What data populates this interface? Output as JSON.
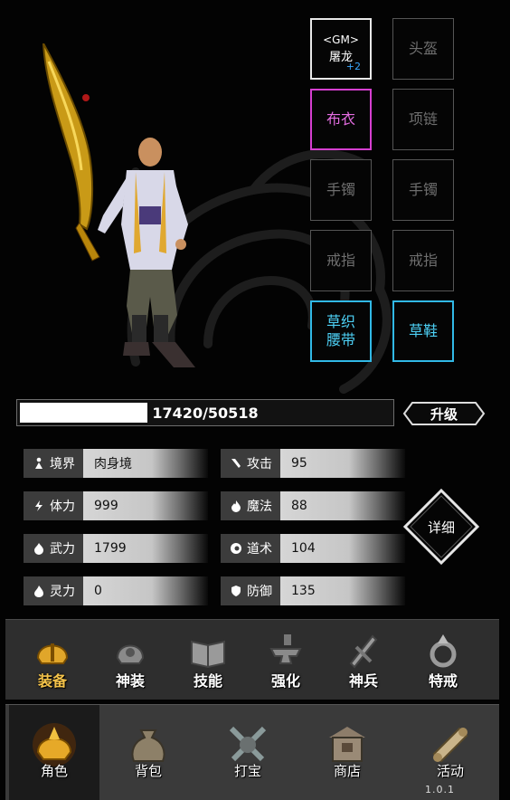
{
  "equipment": {
    "weapon": {
      "tag": "<GM>",
      "name": "屠龙",
      "plus": "+2"
    },
    "helmet": "头盔",
    "armor": "布衣",
    "necklace": "项链",
    "bracelet_left": "手镯",
    "bracelet_right": "手镯",
    "ring_left": "戒指",
    "ring_right": "戒指",
    "belt": "草织\n腰带",
    "boots": "草鞋"
  },
  "experience": {
    "text": "17420/50518",
    "current": 17420,
    "max": 50518
  },
  "upgrade_label": "升级",
  "stats": {
    "realm": {
      "label": "境界",
      "value": "肉身境"
    },
    "attack": {
      "label": "攻击",
      "value": "95"
    },
    "stamina": {
      "label": "体力",
      "value": "999"
    },
    "magic": {
      "label": "魔法",
      "value": "88"
    },
    "martial": {
      "label": "武力",
      "value": "1799"
    },
    "taoism": {
      "label": "道术",
      "value": "104"
    },
    "spirit": {
      "label": "灵力",
      "value": "0"
    },
    "defense": {
      "label": "防御",
      "value": "135"
    }
  },
  "detail_label": "详细",
  "sub_tabs": [
    {
      "label": "装备",
      "icon": "helmet-icon",
      "active": true
    },
    {
      "label": "神装",
      "icon": "divine-gear-icon",
      "active": false
    },
    {
      "label": "技能",
      "icon": "skill-book-icon",
      "active": false
    },
    {
      "label": "强化",
      "icon": "anvil-icon",
      "active": false
    },
    {
      "label": "神兵",
      "icon": "divine-weapon-icon",
      "active": false
    },
    {
      "label": "特戒",
      "icon": "special-ring-icon",
      "active": false
    }
  ],
  "main_tabs": [
    {
      "label": "角色",
      "icon": "character-icon",
      "active": true
    },
    {
      "label": "背包",
      "icon": "bag-icon",
      "active": false
    },
    {
      "label": "打宝",
      "icon": "treasure-hunt-icon",
      "active": false
    },
    {
      "label": "商店",
      "icon": "shop-icon",
      "active": false
    },
    {
      "label": "活动",
      "icon": "event-scroll-icon",
      "active": false
    }
  ],
  "version": "1.0.1",
  "colors": {
    "slot_common": "#6e6e6e",
    "slot_pink": "#d63fd0",
    "slot_cyan": "#31b9e6",
    "active_tab": "#f3c24a"
  }
}
